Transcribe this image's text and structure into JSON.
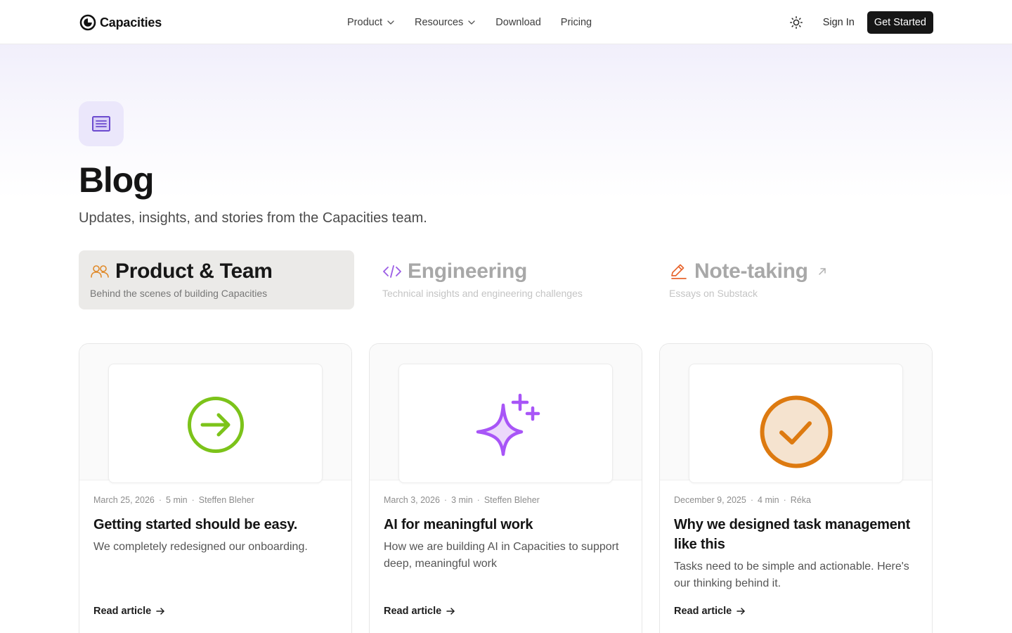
{
  "brand": {
    "name": "Capacities",
    "logo_icon": "capacities-logo-icon"
  },
  "nav": {
    "items": [
      {
        "label": "Product",
        "has_dropdown": true
      },
      {
        "label": "Resources",
        "has_dropdown": true
      },
      {
        "label": "Download",
        "has_dropdown": false
      },
      {
        "label": "Pricing",
        "has_dropdown": false
      }
    ],
    "theme_toggle_icon": "sun-icon",
    "sign_in": "Sign In",
    "get_started": "Get Started"
  },
  "hero": {
    "icon": "document-lines-icon",
    "title": "Blog",
    "subtitle": "Updates, insights, and stories from the Capacities team."
  },
  "categories": [
    {
      "title": "Product & Team",
      "description": "Behind the scenes of building Capacities",
      "icon": "people-icon",
      "active": true
    },
    {
      "title": "Engineering",
      "description": "Technical insights and engineering challenges",
      "icon": "code-icon",
      "active": false
    },
    {
      "title": "Note-taking",
      "description": "Essays on Substack",
      "icon": "pencil-icon",
      "external": true,
      "external_icon": "arrow-up-right-icon",
      "active": false
    }
  ],
  "articles": [
    {
      "date": "March 25, 2026",
      "read_time": "5 min",
      "author": "Steffen Bleher",
      "title": "Getting started should be easy.",
      "excerpt": "We completely redesigned our onboarding.",
      "cta": "Read article",
      "image_icon": "arrow-right-circle-icon"
    },
    {
      "date": "March 3, 2026",
      "read_time": "3 min",
      "author": "Steffen Bleher",
      "title": "AI for meaningful work",
      "excerpt": "How we are building AI in Capacities to support deep, meaningful work",
      "cta": "Read article",
      "image_icon": "sparkles-icon"
    },
    {
      "date": "December 9, 2025",
      "read_time": "4 min",
      "author": "Réka",
      "title": "Why we designed task management like this",
      "excerpt": "Tasks need to be simple and actionable. Here's our thinking behind it.",
      "cta": "Read article",
      "image_icon": "check-circle-icon"
    }
  ],
  "colors": {
    "accent_purple": "#7b5cd6",
    "tab_orange": "#e08a2a",
    "tab_purple": "#9b5de5",
    "tab_red_orange": "#e8662f",
    "green": "#7cc31a",
    "orange": "#dd7a10",
    "button_dark": "#161616"
  }
}
